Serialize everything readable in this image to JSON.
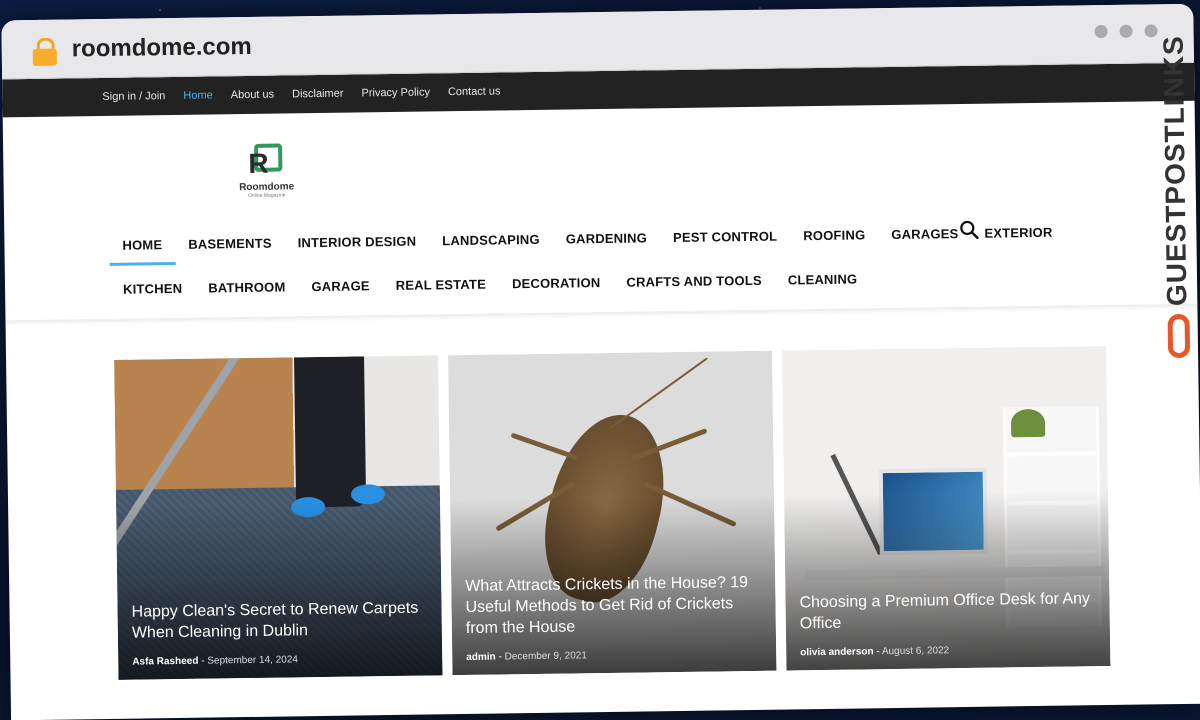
{
  "browser": {
    "url": "roomdome.com"
  },
  "topbar": {
    "links": [
      "Sign in / Join",
      "Home",
      "About us",
      "Disclaimer",
      "Privacy Policy",
      "Contact us"
    ],
    "active": "Home"
  },
  "logo": {
    "name": "Roomdome",
    "tagline": "Online Magazine"
  },
  "nav": {
    "row1": [
      "HOME",
      "BASEMENTS",
      "INTERIOR DESIGN",
      "LANDSCAPING",
      "GARDENING",
      "PEST CONTROL",
      "ROOFING",
      "GARAGES",
      "EXTERIOR"
    ],
    "row2": [
      "KITCHEN",
      "BATHROOM",
      "GARAGE",
      "REAL ESTATE",
      "DECORATION",
      "CRAFTS AND TOOLS",
      "CLEANING"
    ],
    "active": "HOME"
  },
  "cards": [
    {
      "title": "Happy Clean's Secret to Renew Carpets When Cleaning in Dublin",
      "author": "Asfa Rasheed",
      "date": "September 14, 2024"
    },
    {
      "title": "What Attracts Crickets in the House? 19 Useful Methods to Get Rid of Crickets from the House",
      "author": "admin",
      "date": "December 9, 2021"
    },
    {
      "title": "Choosing a Premium Office Desk for Any Office",
      "author": "olivia anderson",
      "date": "August 6, 2022"
    }
  ],
  "watermark": {
    "text": "GUESTPOSTLINKS",
    "color": "#e8562a"
  }
}
